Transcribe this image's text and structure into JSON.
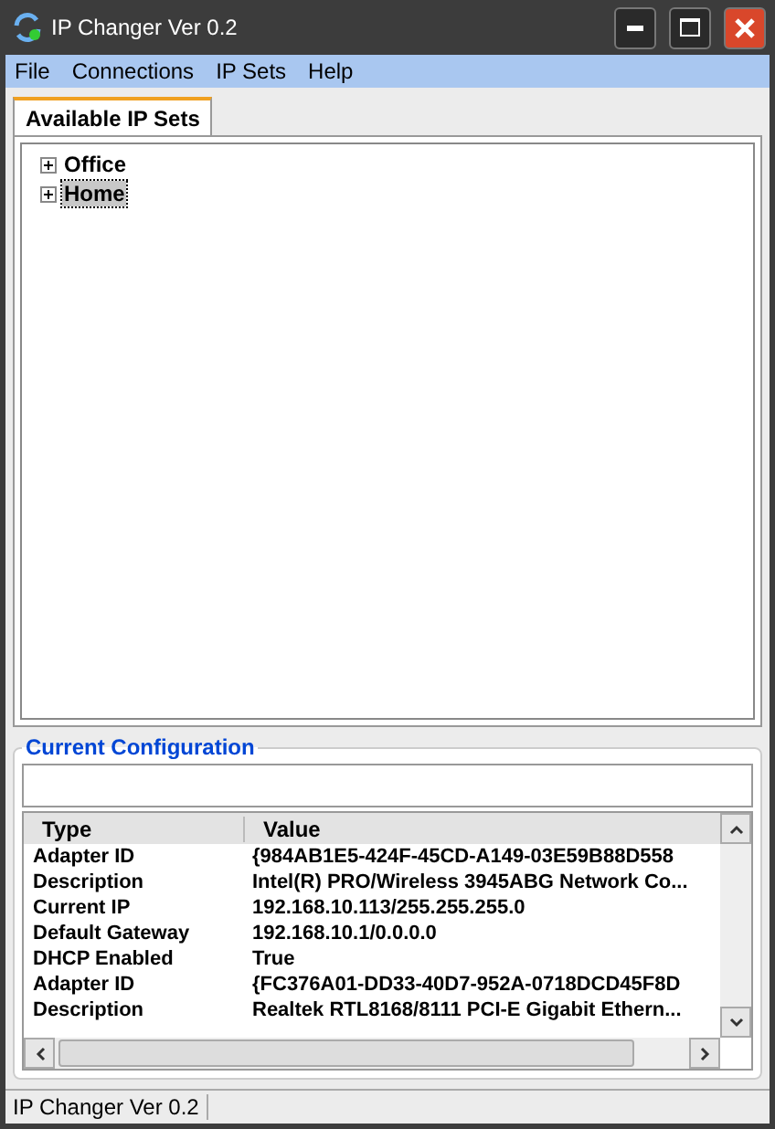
{
  "window": {
    "title": "IP Changer Ver 0.2"
  },
  "menu": [
    "File",
    "Connections",
    "IP Sets",
    "Help"
  ],
  "tabs": [
    {
      "label": "Available IP Sets",
      "selected": true
    }
  ],
  "tree": [
    {
      "label": "Office",
      "selected": false,
      "expanded": false
    },
    {
      "label": "Home",
      "selected": true,
      "expanded": false
    }
  ],
  "current_configuration": {
    "title": "Current Configuration",
    "columns": [
      "Type",
      "Value"
    ],
    "rows": [
      [
        "Adapter ID",
        "{984AB1E5-424F-45CD-A149-03E59B88D558"
      ],
      [
        "Description",
        "Intel(R) PRO/Wireless 3945ABG Network Co..."
      ],
      [
        "Current IP",
        "192.168.10.113/255.255.255.0"
      ],
      [
        "Default Gateway",
        "192.168.10.1/0.0.0.0"
      ],
      [
        "DHCP Enabled",
        "True"
      ],
      [
        "Adapter ID",
        "{FC376A01-DD33-40D7-952A-0718DCD45F8D"
      ],
      [
        "Description",
        "Realtek RTL8168/8111 PCI-E Gigabit Ethern..."
      ]
    ]
  },
  "status_bar": "IP Changer Ver 0.2"
}
